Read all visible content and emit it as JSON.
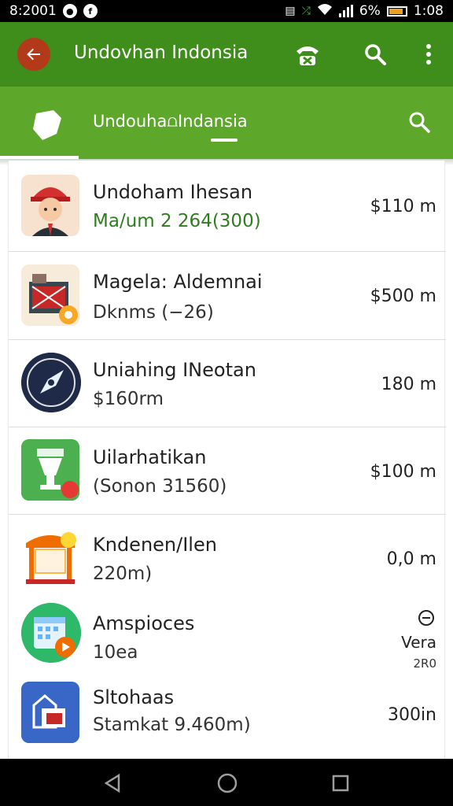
{
  "status_bar": {
    "time_left": "8:2001",
    "battery": "6%",
    "time_right": "1:08"
  },
  "toolbar": {
    "title": "Undovhan Indonsia",
    "icons": [
      "back-arrow-icon",
      "phone-icon",
      "search-icon",
      "more-vert-icon"
    ],
    "accent": "#3f8e1c"
  },
  "tabs": {
    "title": "Undouha⩍Indansia",
    "accent": "#5da82a"
  },
  "apps": [
    {
      "title": "Undoham Ihesan",
      "subtitle": "Ma/um 2 264(300)",
      "price": "$110 m",
      "icon": "avatar-boy-icon"
    },
    {
      "title": "Magela: Aldemnai",
      "subtitle": "Dknms (−26)",
      "price": "$500 m",
      "icon": "store-icon"
    },
    {
      "title": "Uniahing INeotan",
      "subtitle": "$160rm",
      "price": "180 m",
      "icon": "compass-icon"
    },
    {
      "title": "Uilarhatikan",
      "subtitle": "(Sonon 31560)",
      "price": "$100 m",
      "icon": "trophy-icon"
    },
    {
      "title": "Kndenen/Ilen",
      "subtitle": "220m)",
      "price": "0,0 m",
      "icon": "shop-stall-icon"
    },
    {
      "title": "Amspioces",
      "subtitle": "10ea",
      "price_top": "Vera",
      "price_bottom": "2R0",
      "icon": "calendar-icon"
    },
    {
      "title": "Sltohaas",
      "subtitle": "Stamkat 9.460m)",
      "price": "300in",
      "icon": "gallery-icon"
    }
  ],
  "navbar": {
    "icons": [
      "back-triangle-icon",
      "home-circle-icon",
      "recents-square-icon"
    ]
  }
}
